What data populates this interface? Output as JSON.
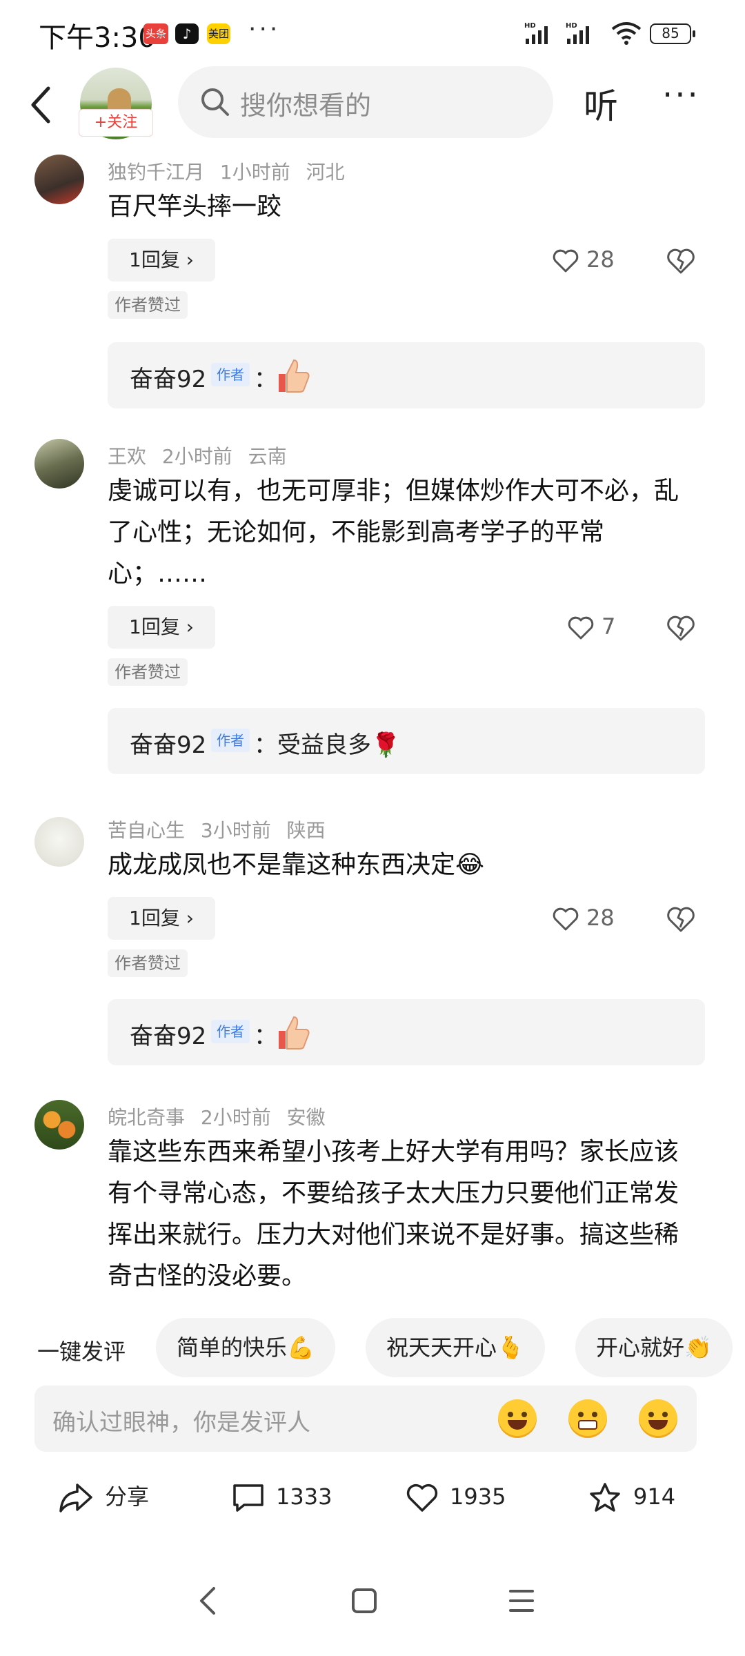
{
  "status_bar": {
    "time": "下午3:30",
    "app_badges": [
      "头条",
      "♪",
      "美团"
    ],
    "more": "···",
    "signal1": "HD",
    "signal2": "HD",
    "battery": "85"
  },
  "header": {
    "follow_label": "+关注",
    "search_placeholder": "搜你想看的",
    "listen_label": "听",
    "more_label": "···"
  },
  "comments": [
    {
      "user": "独钓千江月",
      "time": "1小时前",
      "location": "河北",
      "text": "百尺竿头摔一跤",
      "reply_label": "1回复 ›",
      "likes": "28",
      "author_liked": "作者赞过",
      "author_reply": {
        "name": "奋奋92",
        "tag": "作者",
        "text": "："
      }
    },
    {
      "user": "王欢",
      "time": "2小时前",
      "location": "云南",
      "text": "虔诚可以有，也无可厚非；但媒体炒作大可不必，乱了心性；无论如何，不能影到高考学子的平常心；……",
      "reply_label": "1回复 ›",
      "likes": "7",
      "author_liked": "作者赞过",
      "author_reply": {
        "name": "奋奋92",
        "tag": "作者",
        "text": "：受益良多🌹"
      }
    },
    {
      "user": "苦自心生",
      "time": "3小时前",
      "location": "陕西",
      "text": "成龙成凤也不是靠这种东西决定😂",
      "reply_label": "1回复 ›",
      "likes": "28",
      "author_liked": "作者赞过",
      "author_reply": {
        "name": "奋奋92",
        "tag": "作者",
        "text": "："
      }
    },
    {
      "user": "皖北奇事",
      "time": "2小时前",
      "location": "安徽",
      "text": "靠这些东西来希望小孩考上好大学有用吗？家长应该有个寻常心态，不要给孩子太大压力只要他们正常发挥出来就行。压力大对他们来说不是好事。搞这些稀奇古怪的没必要。"
    }
  ],
  "quick_replies": {
    "label": "一键发评",
    "chips": [
      "简单的快乐💪",
      "祝天天开心🫰",
      "开心就好👏"
    ]
  },
  "input": {
    "placeholder": "确认过眼神，你是发评人"
  },
  "actions": {
    "share": "分享",
    "comments": "1333",
    "likes": "1935",
    "favorites": "914"
  },
  "colors": {
    "accent": "#e8403a",
    "author_tag": "#3d7be0",
    "chip_bg": "#f3f3f4"
  }
}
